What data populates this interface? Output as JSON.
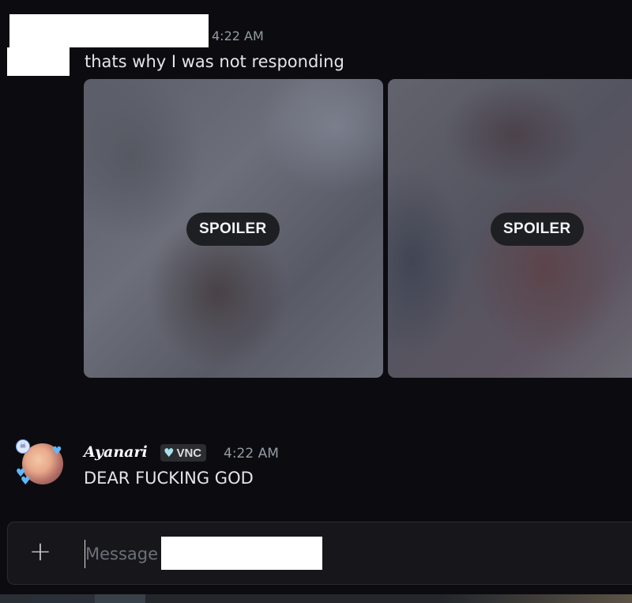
{
  "message1": {
    "timestamp": "4:22 AM",
    "text": "thats why I was not responding",
    "attachments": [
      {
        "label": "SPOILER"
      },
      {
        "label": "SPOILER"
      }
    ]
  },
  "message2": {
    "author": "Ayanari",
    "badge": {
      "icon": "heart-icon",
      "label": "VNC"
    },
    "timestamp": "4:22 AM",
    "text": "DEAR FUCKING GOD"
  },
  "composer": {
    "add_icon": "plus-icon",
    "placeholder": "Message"
  },
  "colors": {
    "background": "#0c0c10",
    "composer": "#17171b",
    "spoiler_pill": "#1e1f22",
    "timestamp": "#949ba4",
    "badge_heart": "#a6e3ef"
  }
}
